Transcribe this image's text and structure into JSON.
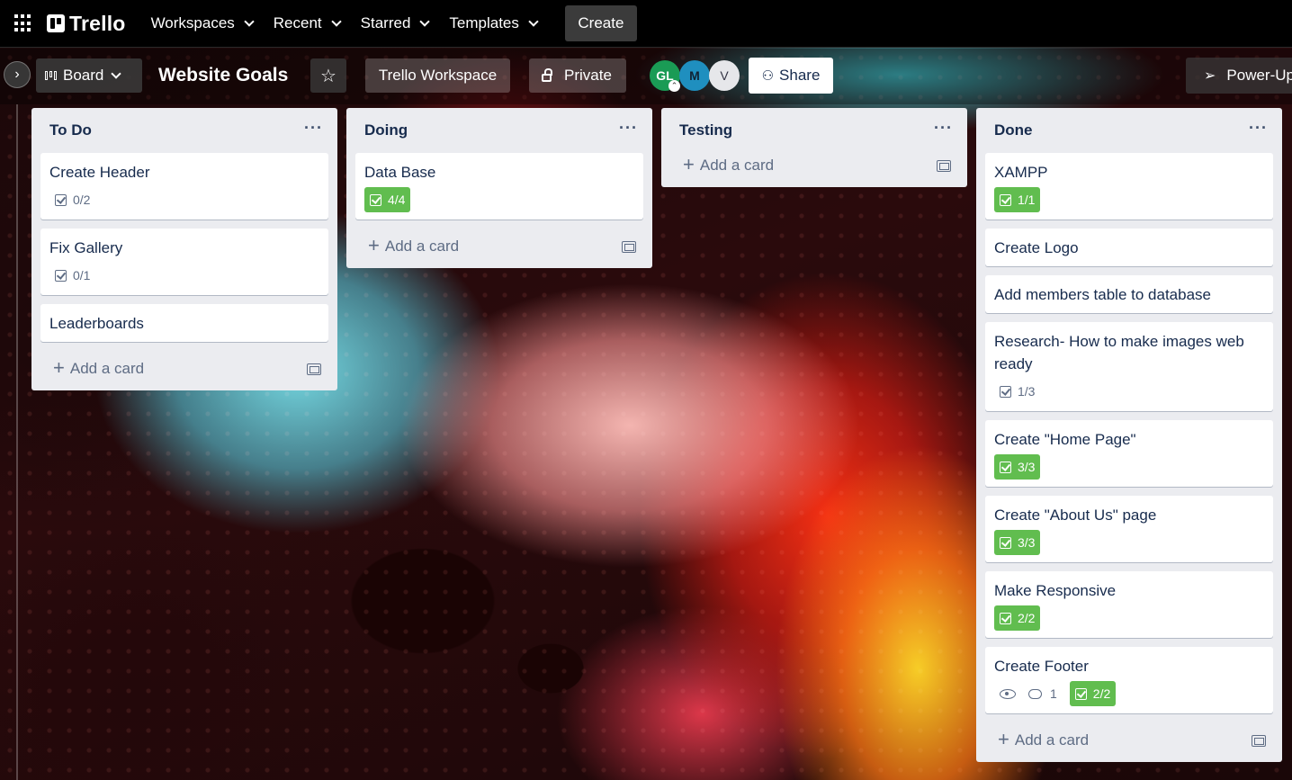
{
  "nav": {
    "brand": "Trello",
    "menu": [
      {
        "label": "Workspaces"
      },
      {
        "label": "Recent"
      },
      {
        "label": "Starred"
      },
      {
        "label": "Templates"
      }
    ],
    "create_label": "Create"
  },
  "board": {
    "view_label": "Board",
    "title": "Website Goals",
    "workspace_label": "Trello Workspace",
    "visibility_label": "Private",
    "members": [
      {
        "initials": "GL",
        "color": "#1a9b55"
      },
      {
        "initials": "M",
        "color": "#1f8fbf"
      },
      {
        "initials": "V",
        "color": "#e6e7ea"
      }
    ],
    "share_label": "Share",
    "powerups_label": "Power-Up"
  },
  "lists": [
    {
      "title": "To Do",
      "cards": [
        {
          "title": "Create Header",
          "checklist": "0/2",
          "complete": false
        },
        {
          "title": "Fix Gallery",
          "checklist": "0/1",
          "complete": false
        },
        {
          "title": "Leaderboards"
        }
      ],
      "add_card_label": "Add a card"
    },
    {
      "title": "Doing",
      "cards": [
        {
          "title": "Data Base",
          "checklist": "4/4",
          "complete": true
        }
      ],
      "add_card_label": "Add a card"
    },
    {
      "title": "Testing",
      "cards": [],
      "add_card_label": "Add a card"
    },
    {
      "title": "Done",
      "cards": [
        {
          "title": "XAMPP",
          "checklist": "1/1",
          "complete": true
        },
        {
          "title": "Create Logo"
        },
        {
          "title": "Add members table to database"
        },
        {
          "title": "Research- How to make images web ready",
          "checklist": "1/3",
          "complete": false
        },
        {
          "title": "Create \"Home Page\"",
          "checklist": "3/3",
          "complete": true
        },
        {
          "title": "Create \"About Us\" page",
          "checklist": "3/3",
          "complete": true
        },
        {
          "title": "Make Responsive",
          "checklist": "2/2",
          "complete": true
        },
        {
          "title": "Create Footer",
          "comments": "1",
          "checklist": "2/2",
          "complete": true
        }
      ],
      "add_card_label": "Add a card"
    }
  ],
  "colors": {
    "nav_bg": "#000000",
    "list_bg": "#ebecf0",
    "checklist_complete": "#61bd4f",
    "text_primary": "#172b4d",
    "text_muted": "#5e6c84"
  }
}
